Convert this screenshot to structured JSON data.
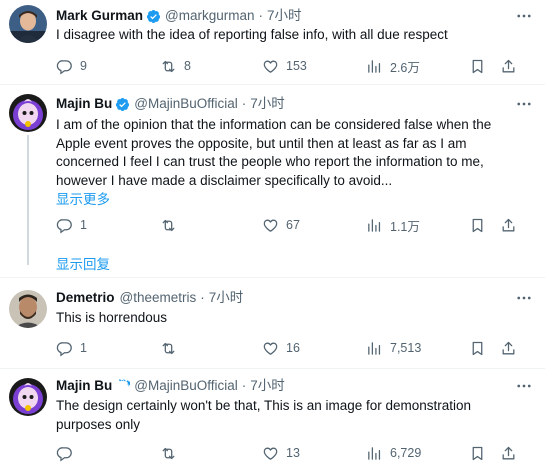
{
  "tweets": [
    {
      "name": "Mark Gurman",
      "handle": "@markgurman",
      "dot": "·",
      "time": "7小时",
      "text": "I disagree with the idea of reporting false info, with all due respect",
      "replies": "9",
      "retweets": "8",
      "likes": "153",
      "views": "2.6万"
    },
    {
      "name": "Majin Bu",
      "handle": "@MajinBuOfficial",
      "dot": "·",
      "time": "7小时",
      "text": "I am of the opinion that the information can be considered false when the Apple event proves the opposite, but until then at least as far as I am concerned I feel I can trust the people who report the information to me, however I have made a disclaimer specifically to avoid...",
      "show_more": "显示更多",
      "replies": "1",
      "retweets": "",
      "likes": "67",
      "views": "1.1万"
    },
    {
      "name": "Demetrio",
      "handle": "@theemetris",
      "dot": "·",
      "time": "7小时",
      "text": "This is horrendous",
      "replies": "1",
      "retweets": "",
      "likes": "16",
      "views": "7,513"
    },
    {
      "name": "Majin Bu",
      "handle": "@MajinBuOfficial",
      "dot": "·",
      "time": "7小时",
      "text": "The design certainly won't be that, This is an image for demonstration purposes only",
      "replies": "",
      "retweets": "",
      "likes": "13",
      "views": "6,729"
    }
  ],
  "show_replies": "显示回复",
  "colors": {
    "text": "#0f1419",
    "secondary": "#536471",
    "link": "#1d9bf0",
    "verified": "#1d9bf0",
    "divider": "#eff3f4"
  },
  "icons": [
    "more-icon",
    "reply-icon",
    "retweet-icon",
    "like-icon",
    "views-icon",
    "bookmark-icon",
    "share-icon",
    "verified-badge-icon"
  ]
}
